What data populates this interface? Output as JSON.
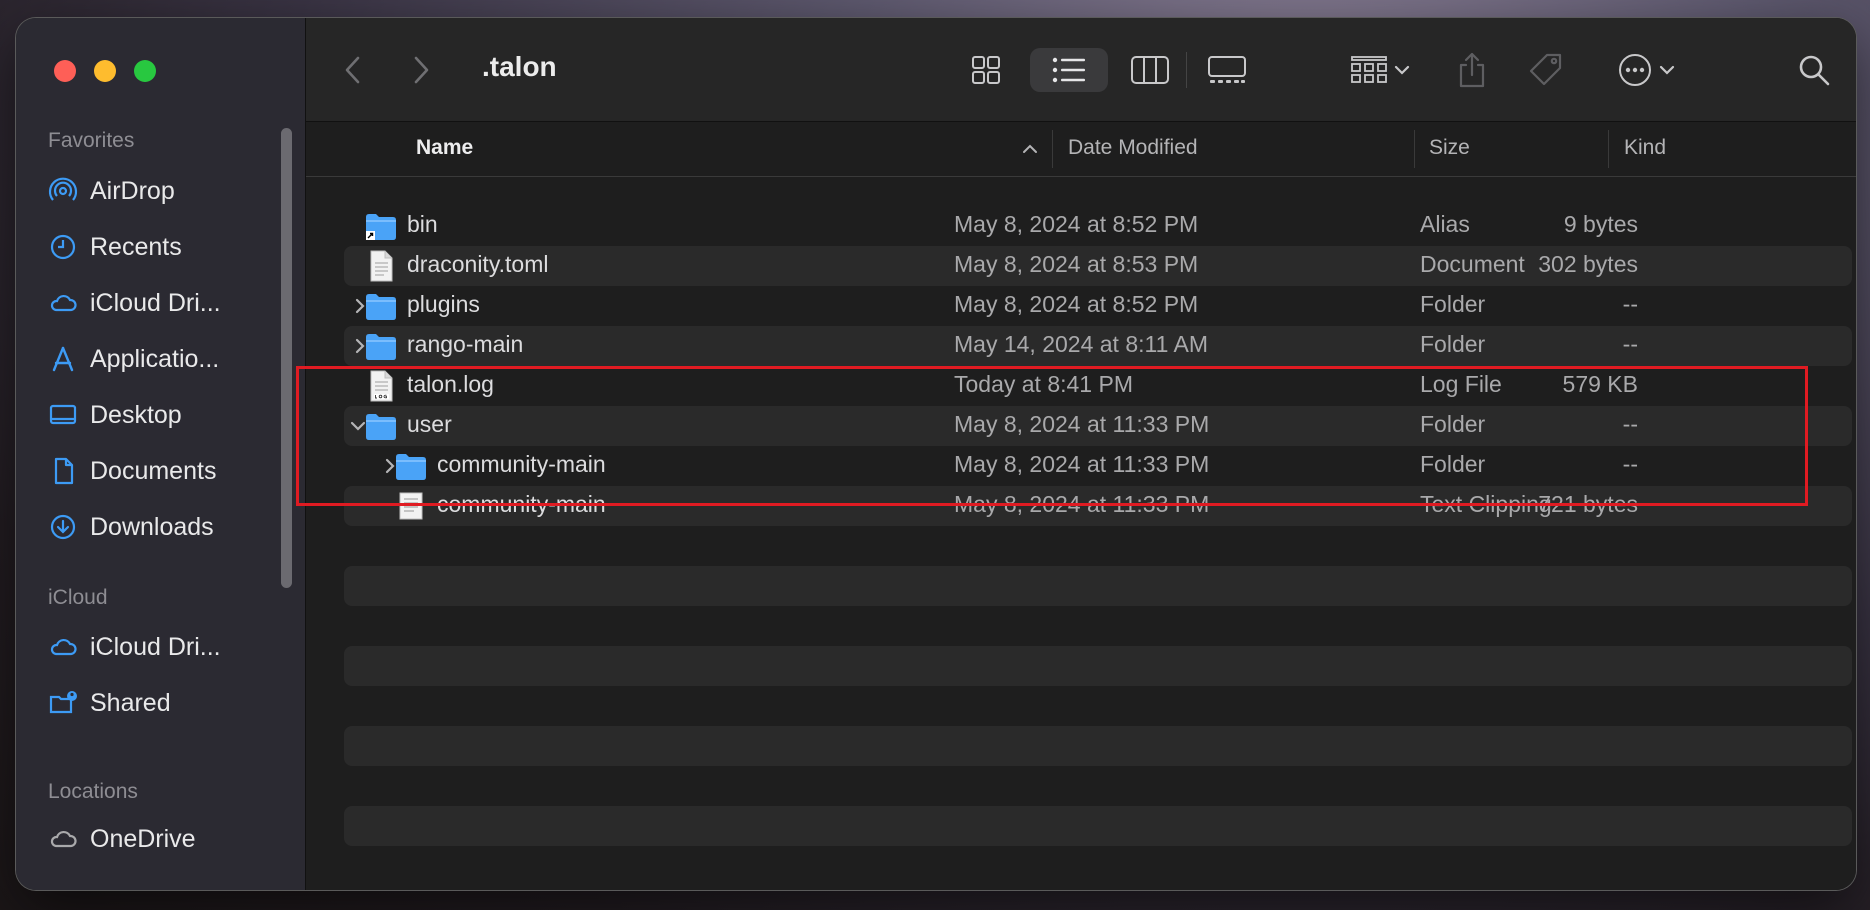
{
  "window": {
    "title": ".talon"
  },
  "sidebar": {
    "favorites_label": "Favorites",
    "favorites": [
      {
        "label": "AirDrop",
        "icon": "airdrop-icon"
      },
      {
        "label": "Recents",
        "icon": "clock-icon"
      },
      {
        "label": "iCloud Dri...",
        "icon": "cloud-icon"
      },
      {
        "label": "Applicatio...",
        "icon": "applications-icon"
      },
      {
        "label": "Desktop",
        "icon": "desktop-icon"
      },
      {
        "label": "Documents",
        "icon": "document-icon"
      },
      {
        "label": "Downloads",
        "icon": "download-icon"
      }
    ],
    "icloud_label": "iCloud",
    "icloud": [
      {
        "label": "iCloud Dri...",
        "icon": "cloud-icon"
      },
      {
        "label": "Shared",
        "icon": "shared-folder-icon"
      }
    ],
    "locations_label": "Locations",
    "locations": [
      {
        "label": "OneDrive",
        "icon": "cloud-outline-icon"
      }
    ]
  },
  "columns": {
    "name": "Name",
    "date": "Date Modified",
    "size": "Size",
    "kind": "Kind"
  },
  "files": [
    {
      "name": "bin",
      "date": "May 8, 2024 at 8:52 PM",
      "size": "9 bytes",
      "kind": "Alias",
      "icon": "alias-folder-icon",
      "expander": "none",
      "indent": 0
    },
    {
      "name": "draconity.toml",
      "date": "May 8, 2024 at 8:53 PM",
      "size": "302 bytes",
      "kind": "Document",
      "icon": "document-file-icon",
      "expander": "none",
      "indent": 0
    },
    {
      "name": "plugins",
      "date": "May 8, 2024 at 8:52 PM",
      "size": "--",
      "kind": "Folder",
      "icon": "folder-icon",
      "expander": "collapsed",
      "indent": 0
    },
    {
      "name": "rango-main",
      "date": "May 14, 2024 at 8:11 AM",
      "size": "--",
      "kind": "Folder",
      "icon": "folder-icon",
      "expander": "collapsed",
      "indent": 0
    },
    {
      "name": "talon.log",
      "date": "Today at 8:41 PM",
      "size": "579 KB",
      "kind": "Log File",
      "icon": "log-file-icon",
      "expander": "none",
      "indent": 0
    },
    {
      "name": "user",
      "date": "May 8, 2024 at 11:33 PM",
      "size": "--",
      "kind": "Folder",
      "icon": "folder-icon",
      "expander": "expanded",
      "indent": 0
    },
    {
      "name": "community-main",
      "date": "May 8, 2024 at 11:33 PM",
      "size": "--",
      "kind": "Folder",
      "icon": "folder-icon",
      "expander": "collapsed",
      "indent": 1
    },
    {
      "name": "community-main",
      "date": "May 8, 2024 at 11:33 PM",
      "size": "721 bytes",
      "kind": "Text Clipping",
      "icon": "text-clipping-icon",
      "expander": "none",
      "indent": 1
    }
  ],
  "colors": {
    "accent": "#3d9bf5",
    "highlight": "#e01b22",
    "folder": "#4aa3f7"
  }
}
